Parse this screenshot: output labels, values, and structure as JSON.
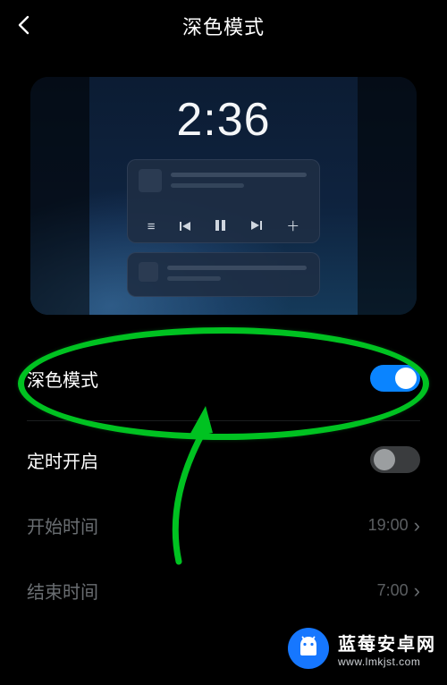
{
  "header": {
    "title": "深色模式"
  },
  "preview": {
    "clock": "2:36",
    "menu_icon": "≡",
    "prev_icon": "▎◀",
    "pause_icon": "❚❚",
    "next_icon": "▶▎",
    "plus_icon": "＋"
  },
  "rows": {
    "darkmode": {
      "label": "深色模式",
      "on": true
    },
    "schedule": {
      "label": "定时开启",
      "on": false
    },
    "start": {
      "label": "开始时间",
      "value": "19:00"
    },
    "end": {
      "label": "结束时间",
      "value": "7:00"
    }
  },
  "chevron": "›",
  "watermark": {
    "name": "蓝莓安卓网",
    "url": "www.lmkjst.com"
  }
}
